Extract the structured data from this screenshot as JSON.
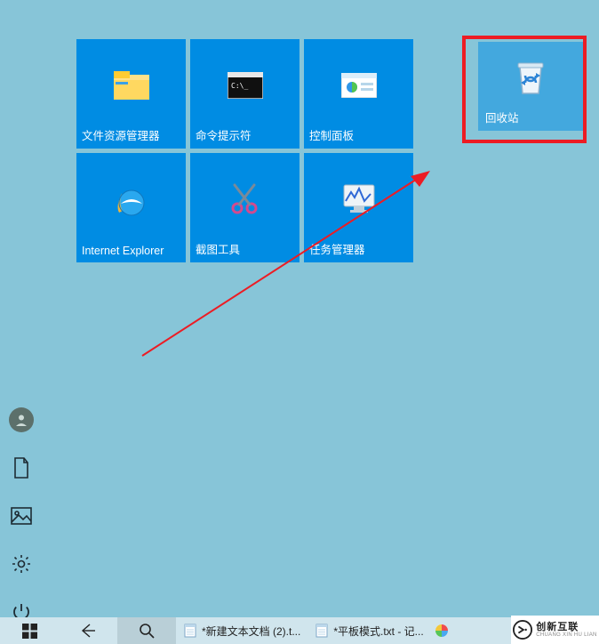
{
  "tiles": {
    "file_explorer": {
      "label": "文件资源管理器"
    },
    "command_prompt": {
      "label": "命令提示符"
    },
    "control_panel": {
      "label": "控制面板"
    },
    "internet_explorer": {
      "label": "Internet Explorer"
    },
    "snipping_tool": {
      "label": "截图工具"
    },
    "task_manager": {
      "label": "任务管理器"
    }
  },
  "recycle_bin": {
    "label": "回收站"
  },
  "taskbar": {
    "entries": {
      "notepad1": {
        "label": "*新建文本文档 (2).t..."
      },
      "notepad2": {
        "label": "*平板模式.txt - 记..."
      }
    }
  },
  "watermark": {
    "line1": "创新互联",
    "line2": "CHUANG XIN HU LIAN"
  }
}
